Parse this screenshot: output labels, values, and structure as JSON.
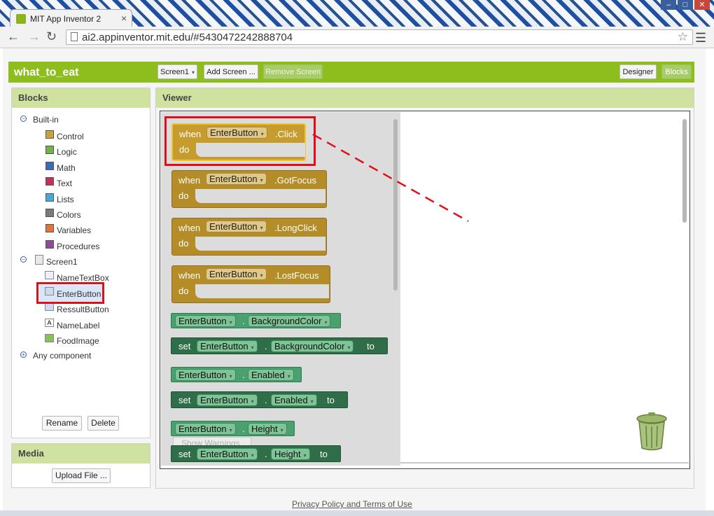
{
  "browser": {
    "tab_title": "MIT App Inventor 2",
    "url": "ai2.appinventor.mit.edu/#5430472242888704"
  },
  "app": {
    "project_name": "what_to_eat",
    "screen_dropdown": "Screen1",
    "add_screen": "Add Screen ...",
    "remove_screen": "Remove Screen",
    "designer": "Designer",
    "blocks": "Blocks"
  },
  "blocks_panel": {
    "header": "Blocks",
    "builtin_label": "Built-in",
    "builtin_items": [
      {
        "label": "Control",
        "color": "#c9a33c"
      },
      {
        "label": "Logic",
        "color": "#74b04c"
      },
      {
        "label": "Math",
        "color": "#3d6bb3"
      },
      {
        "label": "Text",
        "color": "#c0325c"
      },
      {
        "label": "Lists",
        "color": "#47a9d6"
      },
      {
        "label": "Colors",
        "color": "#7a7a7a"
      },
      {
        "label": "Variables",
        "color": "#e2743b"
      },
      {
        "label": "Procedures",
        "color": "#8b4f96"
      }
    ],
    "screen_label": "Screen1",
    "components": [
      "NameTextBox",
      "EnterButton",
      "RessultButton",
      "NameLabel",
      "FoodImage"
    ],
    "any_component": "Any component",
    "rename": "Rename",
    "delete": "Delete"
  },
  "media_panel": {
    "header": "Media",
    "upload": "Upload File ..."
  },
  "viewer": {
    "header": "Viewer",
    "when": "when",
    "do": "do",
    "component": "EnterButton",
    "events": [
      ".Click",
      ".GotFocus",
      ".LongClick",
      ".LostFocus"
    ],
    "dot": ".",
    "set": "set",
    "to": "to",
    "props": [
      "BackgroundColor",
      "Enabled",
      "Height"
    ],
    "show_warnings": "Show Warnings"
  },
  "footer": "Privacy Policy and Terms of Use"
}
